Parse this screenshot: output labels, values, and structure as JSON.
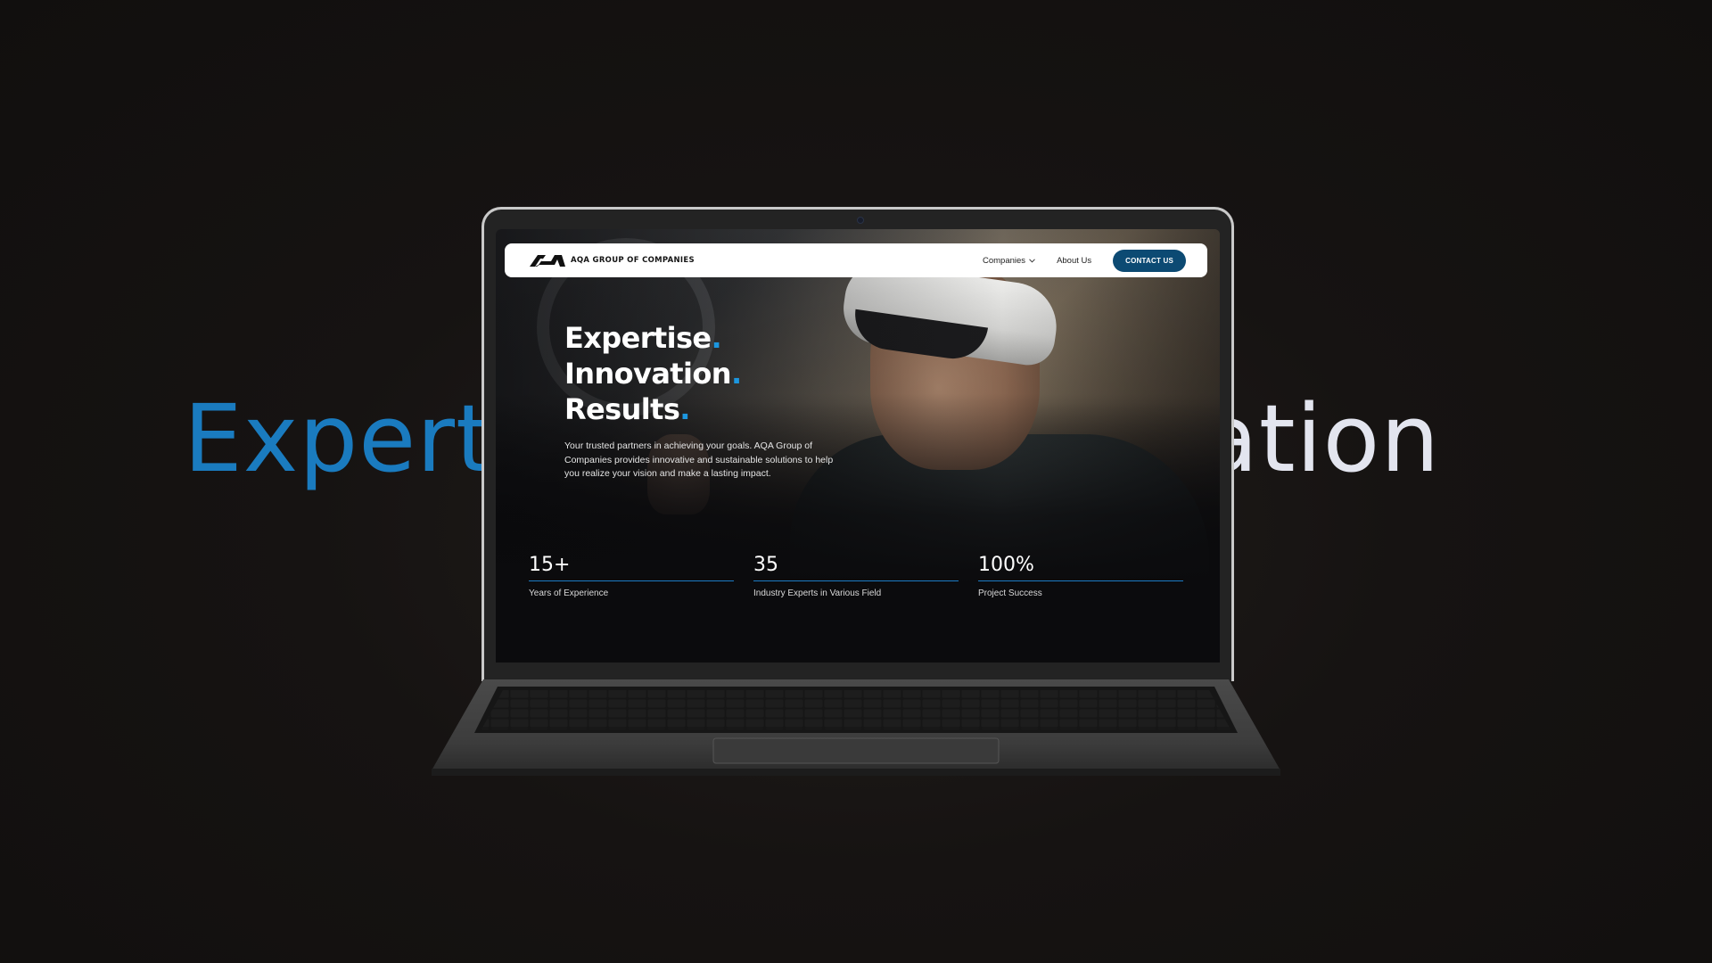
{
  "background": {
    "left_word": "Expertis",
    "right_word": "ovation"
  },
  "navbar": {
    "logo_text": "AQA GROUP OF COMPANIES",
    "links": [
      {
        "label": "Companies",
        "has_dropdown": true
      },
      {
        "label": "About Us",
        "has_dropdown": false
      }
    ],
    "cta_label": "CONTACT US"
  },
  "hero": {
    "lines": [
      "Expertise",
      "Innovation",
      "Results"
    ],
    "dot": ".",
    "description": "Your trusted partners in achieving your goals. AQA Group of Companies provides innovative and sustainable solutions to help you realize your vision and make a lasting impact."
  },
  "stats": [
    {
      "value": "15+",
      "label": "Years of Experience"
    },
    {
      "value": "35",
      "label": "Industry Experts in Various Field"
    },
    {
      "value": "100%",
      "label": "Project Success"
    }
  ],
  "colors": {
    "accent": "#1c96df",
    "button": "#0c4a73",
    "background": "#161312",
    "bg_word_left": "#1a7bbf",
    "bg_word_right": "#e3e5ef"
  },
  "icons": [
    "aqa-logo-icon",
    "chevron-down-icon",
    "camera-icon",
    "trackpad",
    "keyboard"
  ]
}
